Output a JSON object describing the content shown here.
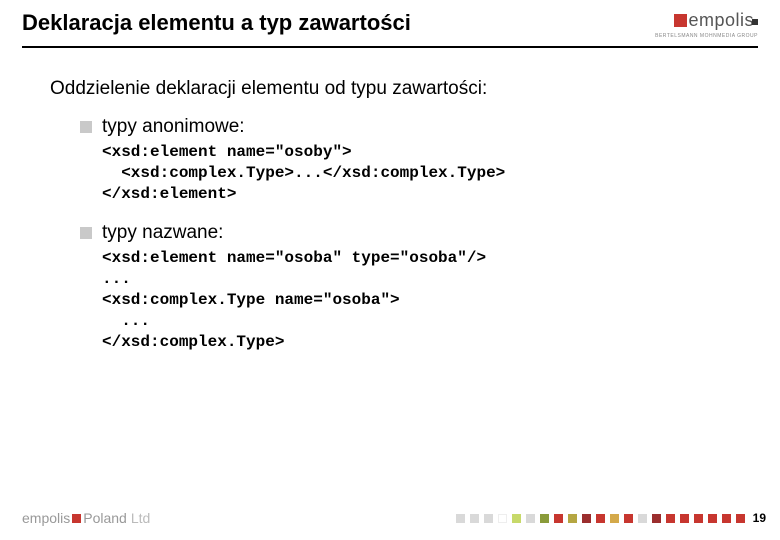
{
  "header": {
    "title": "Deklaracja elementu a typ zawartości",
    "logo_text": "empolis",
    "logo_sub": "BERTELSMANN MOHNMEDIA GROUP"
  },
  "content": {
    "lead": "Oddzielenie deklaracji elementu od typu zawartości:",
    "bullet1": "typy anonimowe:",
    "code1": "<xsd:element name=\"osoby\">\n  <xsd:complex.Type>...</xsd:complex.Type>\n</xsd:element>",
    "bullet2": "typy nazwane:",
    "code2": "<xsd:element name=\"osoba\" type=\"osoba\"/>\n...\n<xsd:complex.Type name=\"osoba\">\n  ...\n</xsd:complex.Type>"
  },
  "footer": {
    "logo_a": "empolis",
    "logo_b": "Poland",
    "logo_c": "Ltd",
    "page": "19",
    "dot_colors": [
      "#d9d9d9",
      "#d9d9d9",
      "#d9d9d9",
      "#ffffff",
      "#c7d96a",
      "#d9d9d9",
      "#8a9b3a",
      "#c7362f",
      "#b5a642",
      "#9b2e2e",
      "#c7362f",
      "#d4a94a",
      "#c7362f",
      "#d9d9d9",
      "#9b2e2e",
      "#c7362f",
      "#c7362f",
      "#c7362f",
      "#c7362f",
      "#c7362f",
      "#c7362f"
    ]
  }
}
